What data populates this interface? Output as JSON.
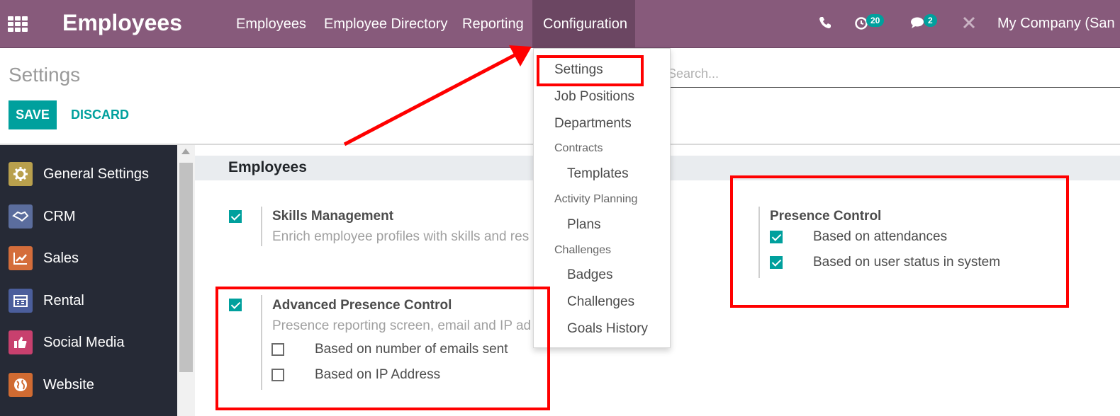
{
  "topbar": {
    "app_title": "Employees",
    "menus": [
      "Employees",
      "Employee Directory",
      "Reporting",
      "Configuration"
    ],
    "activity_count": "20",
    "message_count": "2",
    "company": "My Company (San"
  },
  "control_panel": {
    "breadcrumb": "Settings",
    "save_label": "SAVE",
    "discard_label": "DISCARD",
    "search_placeholder": "Search..."
  },
  "sidebar": {
    "items": [
      {
        "label": "General Settings",
        "icon": "gear-icon",
        "color": "#b9a04d"
      },
      {
        "label": "CRM",
        "icon": "handshake-icon",
        "color": "#5b6d9d"
      },
      {
        "label": "Sales",
        "icon": "chart-up-icon",
        "color": "#d46d3b"
      },
      {
        "label": "Rental",
        "icon": "calendar-icon",
        "color": "#4b5e9c"
      },
      {
        "label": "Social Media",
        "icon": "thumbs-up-icon",
        "color": "#c8406e"
      },
      {
        "label": "Website",
        "icon": "globe-icon",
        "color": "#d06b32"
      }
    ]
  },
  "content": {
    "section_title": "Employees",
    "skills": {
      "title": "Skills Management",
      "desc": "Enrich employee profiles with skills and res",
      "checked": true
    },
    "advanced_presence": {
      "title": "Advanced Presence Control",
      "desc": "Presence reporting screen, email and IP ad",
      "checked": true,
      "options": [
        {
          "label": "Based on number of emails sent",
          "checked": false
        },
        {
          "label": "Based on IP Address",
          "checked": false
        }
      ]
    },
    "presence_control": {
      "title": "Presence Control",
      "options": [
        {
          "label": "Based on attendances",
          "checked": true
        },
        {
          "label": "Based on user status in system",
          "checked": true
        }
      ]
    }
  },
  "dropdown": {
    "items": {
      "settings": "Settings",
      "job_positions": "Job Positions",
      "departments": "Departments",
      "contracts_header": "Contracts",
      "templates": "Templates",
      "activity_planning_header": "Activity Planning",
      "plans": "Plans",
      "challenges_header": "Challenges",
      "badges": "Badges",
      "challenges": "Challenges",
      "goals_history": "Goals History"
    }
  },
  "colors": {
    "brand": "#875a7b",
    "accent": "#00a09d",
    "annotation": "#ff0000"
  }
}
